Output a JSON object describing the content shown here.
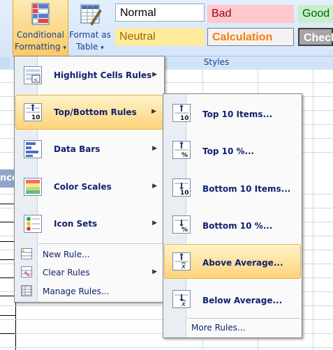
{
  "ribbon": {
    "conditional_formatting": {
      "line1": "Conditional",
      "line2": "Formatting",
      "dropdown": "▾"
    },
    "format_as_table": {
      "line1": "Format as",
      "line2": "Table",
      "dropdown": "▾"
    },
    "styles": [
      {
        "label": "Normal",
        "bg": "#ffffff",
        "fg": "#000000",
        "border": "#9aa7bb"
      },
      {
        "label": "Bad",
        "bg": "#ffc7ce",
        "fg": "#9c0006",
        "border": "#ffc7ce"
      },
      {
        "label": "Good",
        "bg": "#c6efce",
        "fg": "#006100",
        "border": "#c6efce"
      },
      {
        "label": "Neutral",
        "bg": "#ffeb9c",
        "fg": "#9c6500",
        "border": "#ffeb9c"
      },
      {
        "label": "Calculation",
        "bg": "#f2f2f2",
        "fg": "#fa7d00",
        "border": "#7f7f7f"
      },
      {
        "label": "Check",
        "bg": "#a5a5a5",
        "fg": "#ffffff",
        "border": "#3f3f3f"
      }
    ],
    "group_label": "Styles"
  },
  "sheet": {
    "header_fragment": "nce"
  },
  "main_menu": {
    "items": [
      {
        "label": "Highlight Cells Rules",
        "key": "H"
      },
      {
        "label": "Top/Bottom Rules",
        "key": "T"
      },
      {
        "label": "Data Bars",
        "key": "D"
      },
      {
        "label": "Color Scales",
        "key": "S"
      },
      {
        "label": "Icon Sets",
        "key": "I"
      }
    ],
    "new_rule": "New Rule...",
    "clear_rules": "Clear Rules",
    "manage_rules": "Manage Rules...",
    "arrow": "▶"
  },
  "submenu": {
    "items": [
      {
        "label": "Top 10 Items...",
        "badge": "10"
      },
      {
        "label": "Top 10 %...",
        "badge": "%"
      },
      {
        "label": "Bottom 10 Items...",
        "badge": "10"
      },
      {
        "label": "Bottom 10 %...",
        "badge": "%"
      },
      {
        "label": "Above Average...",
        "badge": "x̄"
      },
      {
        "label": "Below Average...",
        "badge": "x̄"
      }
    ],
    "more_rules": "More Rules..."
  }
}
